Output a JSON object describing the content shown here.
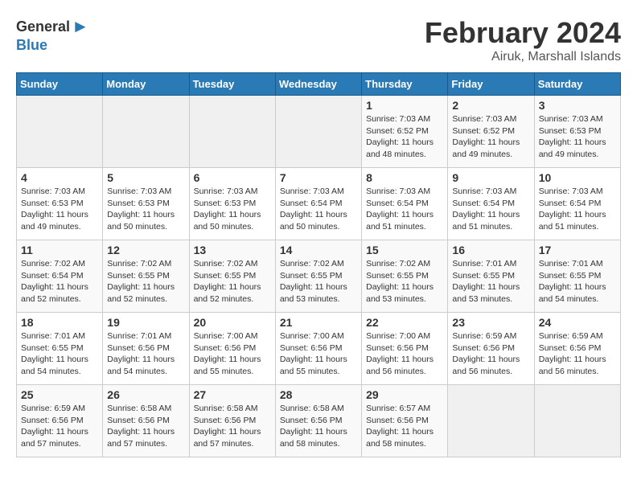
{
  "logo": {
    "general": "General",
    "blue": "Blue"
  },
  "title": "February 2024",
  "location": "Airuk, Marshall Islands",
  "days_of_week": [
    "Sunday",
    "Monday",
    "Tuesday",
    "Wednesday",
    "Thursday",
    "Friday",
    "Saturday"
  ],
  "weeks": [
    [
      {
        "day": "",
        "sunrise": "",
        "sunset": "",
        "daylight": ""
      },
      {
        "day": "",
        "sunrise": "",
        "sunset": "",
        "daylight": ""
      },
      {
        "day": "",
        "sunrise": "",
        "sunset": "",
        "daylight": ""
      },
      {
        "day": "",
        "sunrise": "",
        "sunset": "",
        "daylight": ""
      },
      {
        "day": "1",
        "sunrise": "Sunrise: 7:03 AM",
        "sunset": "Sunset: 6:52 PM",
        "daylight": "Daylight: 11 hours and 48 minutes."
      },
      {
        "day": "2",
        "sunrise": "Sunrise: 7:03 AM",
        "sunset": "Sunset: 6:52 PM",
        "daylight": "Daylight: 11 hours and 49 minutes."
      },
      {
        "day": "3",
        "sunrise": "Sunrise: 7:03 AM",
        "sunset": "Sunset: 6:53 PM",
        "daylight": "Daylight: 11 hours and 49 minutes."
      }
    ],
    [
      {
        "day": "4",
        "sunrise": "Sunrise: 7:03 AM",
        "sunset": "Sunset: 6:53 PM",
        "daylight": "Daylight: 11 hours and 49 minutes."
      },
      {
        "day": "5",
        "sunrise": "Sunrise: 7:03 AM",
        "sunset": "Sunset: 6:53 PM",
        "daylight": "Daylight: 11 hours and 50 minutes."
      },
      {
        "day": "6",
        "sunrise": "Sunrise: 7:03 AM",
        "sunset": "Sunset: 6:53 PM",
        "daylight": "Daylight: 11 hours and 50 minutes."
      },
      {
        "day": "7",
        "sunrise": "Sunrise: 7:03 AM",
        "sunset": "Sunset: 6:54 PM",
        "daylight": "Daylight: 11 hours and 50 minutes."
      },
      {
        "day": "8",
        "sunrise": "Sunrise: 7:03 AM",
        "sunset": "Sunset: 6:54 PM",
        "daylight": "Daylight: 11 hours and 51 minutes."
      },
      {
        "day": "9",
        "sunrise": "Sunrise: 7:03 AM",
        "sunset": "Sunset: 6:54 PM",
        "daylight": "Daylight: 11 hours and 51 minutes."
      },
      {
        "day": "10",
        "sunrise": "Sunrise: 7:03 AM",
        "sunset": "Sunset: 6:54 PM",
        "daylight": "Daylight: 11 hours and 51 minutes."
      }
    ],
    [
      {
        "day": "11",
        "sunrise": "Sunrise: 7:02 AM",
        "sunset": "Sunset: 6:54 PM",
        "daylight": "Daylight: 11 hours and 52 minutes."
      },
      {
        "day": "12",
        "sunrise": "Sunrise: 7:02 AM",
        "sunset": "Sunset: 6:55 PM",
        "daylight": "Daylight: 11 hours and 52 minutes."
      },
      {
        "day": "13",
        "sunrise": "Sunrise: 7:02 AM",
        "sunset": "Sunset: 6:55 PM",
        "daylight": "Daylight: 11 hours and 52 minutes."
      },
      {
        "day": "14",
        "sunrise": "Sunrise: 7:02 AM",
        "sunset": "Sunset: 6:55 PM",
        "daylight": "Daylight: 11 hours and 53 minutes."
      },
      {
        "day": "15",
        "sunrise": "Sunrise: 7:02 AM",
        "sunset": "Sunset: 6:55 PM",
        "daylight": "Daylight: 11 hours and 53 minutes."
      },
      {
        "day": "16",
        "sunrise": "Sunrise: 7:01 AM",
        "sunset": "Sunset: 6:55 PM",
        "daylight": "Daylight: 11 hours and 53 minutes."
      },
      {
        "day": "17",
        "sunrise": "Sunrise: 7:01 AM",
        "sunset": "Sunset: 6:55 PM",
        "daylight": "Daylight: 11 hours and 54 minutes."
      }
    ],
    [
      {
        "day": "18",
        "sunrise": "Sunrise: 7:01 AM",
        "sunset": "Sunset: 6:55 PM",
        "daylight": "Daylight: 11 hours and 54 minutes."
      },
      {
        "day": "19",
        "sunrise": "Sunrise: 7:01 AM",
        "sunset": "Sunset: 6:56 PM",
        "daylight": "Daylight: 11 hours and 54 minutes."
      },
      {
        "day": "20",
        "sunrise": "Sunrise: 7:00 AM",
        "sunset": "Sunset: 6:56 PM",
        "daylight": "Daylight: 11 hours and 55 minutes."
      },
      {
        "day": "21",
        "sunrise": "Sunrise: 7:00 AM",
        "sunset": "Sunset: 6:56 PM",
        "daylight": "Daylight: 11 hours and 55 minutes."
      },
      {
        "day": "22",
        "sunrise": "Sunrise: 7:00 AM",
        "sunset": "Sunset: 6:56 PM",
        "daylight": "Daylight: 11 hours and 56 minutes."
      },
      {
        "day": "23",
        "sunrise": "Sunrise: 6:59 AM",
        "sunset": "Sunset: 6:56 PM",
        "daylight": "Daylight: 11 hours and 56 minutes."
      },
      {
        "day": "24",
        "sunrise": "Sunrise: 6:59 AM",
        "sunset": "Sunset: 6:56 PM",
        "daylight": "Daylight: 11 hours and 56 minutes."
      }
    ],
    [
      {
        "day": "25",
        "sunrise": "Sunrise: 6:59 AM",
        "sunset": "Sunset: 6:56 PM",
        "daylight": "Daylight: 11 hours and 57 minutes."
      },
      {
        "day": "26",
        "sunrise": "Sunrise: 6:58 AM",
        "sunset": "Sunset: 6:56 PM",
        "daylight": "Daylight: 11 hours and 57 minutes."
      },
      {
        "day": "27",
        "sunrise": "Sunrise: 6:58 AM",
        "sunset": "Sunset: 6:56 PM",
        "daylight": "Daylight: 11 hours and 57 minutes."
      },
      {
        "day": "28",
        "sunrise": "Sunrise: 6:58 AM",
        "sunset": "Sunset: 6:56 PM",
        "daylight": "Daylight: 11 hours and 58 minutes."
      },
      {
        "day": "29",
        "sunrise": "Sunrise: 6:57 AM",
        "sunset": "Sunset: 6:56 PM",
        "daylight": "Daylight: 11 hours and 58 minutes."
      },
      {
        "day": "",
        "sunrise": "",
        "sunset": "",
        "daylight": ""
      },
      {
        "day": "",
        "sunrise": "",
        "sunset": "",
        "daylight": ""
      }
    ]
  ]
}
